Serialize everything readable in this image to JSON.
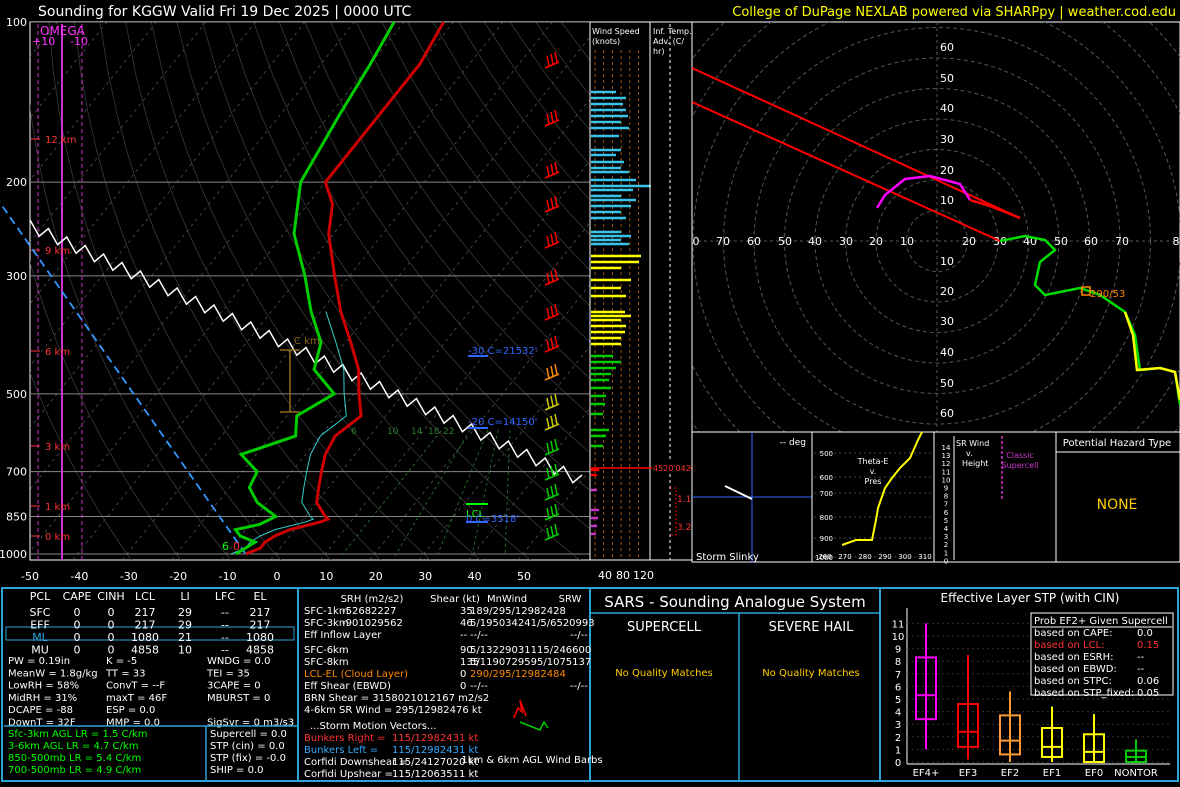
{
  "header": {
    "title": "Sounding for KGGW Valid  Fri 19 Dec 2025 | 0000 UTC",
    "credit": "College of DuPage NEXLAB powered via SHARPpy | weather.cod.edu"
  },
  "skewt": {
    "omega_label": "OMEGA",
    "omega_left": "+10",
    "omega_right": "-10",
    "pressure_ticks": [
      "100",
      "200",
      "300",
      "500",
      "700",
      "850",
      "1000"
    ],
    "temp_ticks": [
      "-50",
      "-40",
      "-30",
      "-20",
      "-10",
      "0",
      "10",
      "20",
      "30",
      "40",
      "50"
    ],
    "height_labels": [
      "12 km",
      "9 km",
      "6 km",
      "3 km",
      "1 km",
      "0 km"
    ],
    "mixing_ratio_labels": [
      "6",
      "10",
      "14",
      "18",
      "22"
    ],
    "dgz_top": "-30 C=21532'",
    "dgz_mid": "-20 C=14150'",
    "lcl_label": "LCL",
    "zero_c_label": "0 C=3518'",
    "sfc_dewpoint": "6",
    "sfc_temp": "0",
    "el_label": "EL",
    "lfc_label": "LFC",
    "ckm_label": "C km"
  },
  "wind_speed": {
    "title": "Wind Speed (knots)",
    "ticks": [
      "40",
      "80",
      "120"
    ],
    "marker_label": "4520'042"
  },
  "inferred_temp": {
    "title": "Inf. Temp. Adv. (C/hr)",
    "values": [
      "1.1",
      "3.2"
    ]
  },
  "hodograph": {
    "y_ticks": [
      "60",
      "50",
      "40",
      "30",
      "20",
      "10",
      "10",
      "20",
      "30",
      "40",
      "50",
      "60"
    ],
    "x_ticks": [
      "0",
      "70",
      "60",
      "50",
      "40",
      "30",
      "20",
      "10",
      "20",
      "30",
      "40",
      "50",
      "60",
      "70",
      "8"
    ],
    "storm_motion": "290/53"
  },
  "slinky": {
    "label": "Storm Slinky",
    "deg": "-- deg"
  },
  "theta": {
    "title": "Theta-E v. Pres",
    "pressures": [
      "500",
      "600",
      "700",
      "800",
      "900",
      "1000"
    ],
    "temps": [
      "260",
      "270",
      "280",
      "290",
      "300",
      "310"
    ]
  },
  "srwind": {
    "title": "SR Wind v. Height",
    "classic": "Classic Supercell",
    "heights": [
      "14",
      "13",
      "12",
      "11",
      "10",
      "9",
      "8",
      "7",
      "6",
      "5",
      "4",
      "3",
      "2",
      "1",
      "0"
    ]
  },
  "hazard": {
    "title": "Potential Hazard Type",
    "value": "NONE"
  },
  "parcels": {
    "headers": [
      "PCL",
      "CAPE",
      "CINH",
      "LCL",
      "LI",
      "LFC",
      "EL"
    ],
    "rows": [
      [
        "SFC",
        "0",
        "0",
        "217",
        "29",
        "--",
        "217"
      ],
      [
        "EFF",
        "0",
        "0",
        "217",
        "29",
        "--",
        "217"
      ],
      [
        "ML",
        "0",
        "0",
        "1080",
        "21",
        "--",
        "1080"
      ],
      [
        "MU",
        "0",
        "0",
        "4858",
        "10",
        "--",
        "4858"
      ]
    ]
  },
  "indices": [
    [
      "PW = 0.19in",
      "K = -5",
      "WNDG = 0.0"
    ],
    [
      "MeanW = 1.8g/kg",
      "TT = 33",
      "TEI = 35"
    ],
    [
      "LowRH = 58%",
      "ConvT = --F",
      "3CAPE = 0"
    ],
    [
      "MidRH = 31%",
      "maxT = 46F",
      "MBURST = 0"
    ],
    [
      "DCAPE = -88",
      "ESP = 0.0",
      ""
    ],
    [
      "DownT = 32F",
      "MMP = 0.0",
      "SigSvr = 0 m3/s3"
    ]
  ],
  "lapse_rates": [
    "Sfc-3km AGL LR = 1.5 C/km",
    "3-6km AGL LR = 4.7 C/km",
    "850-500mb LR = 5.4 C/km",
    "700-500mb LR = 4.9 C/km"
  ],
  "composites": [
    "Supercell = 0.0",
    "STP (cin) = 0.0",
    "STP (fix) = -0.0",
    "SHIP = 0.0"
  ],
  "kinematics": {
    "headers": [
      "SRH (m2/s2)",
      "Shear (kt)",
      "MnWind",
      "SRW"
    ],
    "rows": [
      {
        "label": "SFC-1km",
        "srh": "-52682227",
        "shear": "35",
        "mn": "189/295/12982428",
        "color": "#ffffff"
      },
      {
        "label": "SFC-3km",
        "srh": "-901029562",
        "shear": "46",
        "mn": "5/195034241/5/6520993",
        "color": "#ffffff"
      },
      {
        "label": "Eff Inflow Layer",
        "srh": "",
        "shear": "--",
        "mn": "--/--",
        "srw": "--/--",
        "color": "#ffffff"
      },
      {
        "label": "SFC-6km",
        "srh": "",
        "shear": "90",
        "mn": "5/13229031115/246600",
        "color": "#ffffff"
      },
      {
        "label": "SFC-8km",
        "srh": "",
        "shear": "135",
        "mn": "5/1190729595/1075137",
        "color": "#ffffff"
      },
      {
        "label": "LCL-EL (Cloud Layer)",
        "srh": "",
        "shear": "0",
        "mn": "290/295/12982484",
        "color": "#ff8800"
      },
      {
        "label": "Eff Shear (EBWD)",
        "srh": "",
        "shear": "0",
        "mn": "--/--",
        "srw": "--/--",
        "color": "#ffffff"
      }
    ],
    "brn": "BRN Shear = 3158021012167 m2/s2",
    "srwind": "4-6km SR Wind =   295/12982476 kt",
    "storm_title": "...Storm Motion Vectors...",
    "vectors": [
      {
        "label": "Bunkers Right =",
        "value": "115/12982431 kt",
        "color": "#ff3333"
      },
      {
        "label": "Bunkers Left =",
        "value": "115/12982431 kt",
        "color": "#33aaff"
      },
      {
        "label": "Corfidi Downshear =",
        "value": "115/24127020 kt",
        "color": "#ffffff"
      },
      {
        "label": "Corfidi Upshear =",
        "value": "115/12063511 kt",
        "color": "#ffffff"
      }
    ],
    "barbs_label": "1km & 6km AGL Wind Barbs"
  },
  "sars": {
    "title": "SARS - Sounding Analogue System",
    "supercell": "SUPERCELL",
    "hail": "SEVERE HAIL",
    "match": "No Quality Matches"
  },
  "stp": {
    "title": "Effective Layer STP (with CIN)",
    "y_ticks": [
      "0",
      "1",
      "2",
      "3",
      "4",
      "5",
      "6",
      "7",
      "8",
      "9",
      "10",
      "11"
    ],
    "categories": [
      "EF4+",
      "EF3",
      "EF2",
      "EF1",
      "EF0",
      "NONTOR"
    ],
    "prob_title": "Prob EF2+ Given Supercell",
    "probs": [
      {
        "label": "based on CAPE:",
        "value": "0.0",
        "color": "#ffffff"
      },
      {
        "label": "based on LCL:",
        "value": "0.15",
        "color": "#ff3333"
      },
      {
        "label": "based on ESRH:",
        "value": "--",
        "color": "#ffffff"
      },
      {
        "label": "based on EBWD:",
        "value": "--",
        "color": "#ffffff"
      },
      {
        "label": "based on STPC:",
        "value": "0.06",
        "color": "#ffffff"
      },
      {
        "label": "based on STP_fixed:",
        "value": "0.05",
        "color": "#ffffff"
      }
    ]
  },
  "chart_data": [
    {
      "type": "line",
      "title": "",
      "xlabel": "",
      "ylabel": "",
      "y_scale": "log-pressure",
      "xlim": [
        -50,
        50
      ],
      "ylim": [
        1050,
        100
      ],
      "series": [
        {
          "name": "",
          "color": "#cc0000",
          "points": [
            [
              1000,
              -6
            ],
            [
              975,
              -4
            ],
            [
              950,
              -4
            ],
            [
              925,
              -3
            ],
            [
              900,
              -1
            ],
            [
              870,
              4
            ],
            [
              860,
              5
            ],
            [
              850,
              4
            ],
            [
              800,
              0
            ],
            [
              750,
              -2
            ],
            [
              700,
              -4
            ],
            [
              650,
              -6
            ],
            [
              600,
              -7
            ],
            [
              550,
              -5
            ],
            [
              500,
              -9
            ],
            [
              450,
              -13
            ],
            [
              400,
              -19
            ],
            [
              350,
              -26
            ],
            [
              300,
              -33
            ],
            [
              250,
              -41
            ],
            [
              220,
              -45
            ],
            [
              200,
              -50
            ],
            [
              180,
              -50
            ],
            [
              150,
              -50
            ],
            [
              120,
              -50
            ],
            [
              100,
              -52
            ]
          ]
        },
        {
          "name": "",
          "color": "#00cc00",
          "points": [
            [
              1000,
              -8
            ],
            [
              975,
              -7
            ],
            [
              950,
              -6
            ],
            [
              925,
              -10
            ],
            [
              900,
              -12
            ],
            [
              880,
              -8
            ],
            [
              850,
              -6
            ],
            [
              800,
              -12
            ],
            [
              750,
              -16
            ],
            [
              700,
              -17
            ],
            [
              650,
              -23
            ],
            [
              600,
              -15
            ],
            [
              550,
              -18
            ],
            [
              500,
              -14
            ],
            [
              450,
              -22
            ],
            [
              400,
              -25
            ],
            [
              350,
              -32
            ],
            [
              300,
              -39
            ],
            [
              250,
              -48
            ],
            [
              200,
              -55
            ],
            [
              150,
              -58
            ],
            [
              120,
              -60
            ],
            [
              100,
              -62
            ]
          ]
        }
      ]
    },
    {
      "type": "bar",
      "title": "",
      "xlabel": "",
      "ylabel": "",
      "categories": [
        "EF4+",
        "EF3",
        "EF2",
        "EF1",
        "EF0",
        "NONTOR"
      ],
      "series": [
        {
          "name": "",
          "stat": "box",
          "whisker_low": [
            1,
            0.2,
            0,
            0,
            0,
            0
          ],
          "q1": [
            3.4,
            1.2,
            0.6,
            0.4,
            0,
            0
          ],
          "median": [
            5.3,
            2.4,
            1.7,
            1.2,
            0.8,
            0.4
          ],
          "q3": [
            8.3,
            4.6,
            3.7,
            2.7,
            2.2,
            0.9
          ],
          "whisker_high": [
            11,
            8.5,
            5.6,
            4.4,
            3.8,
            1.8
          ]
        }
      ]
    }
  ]
}
